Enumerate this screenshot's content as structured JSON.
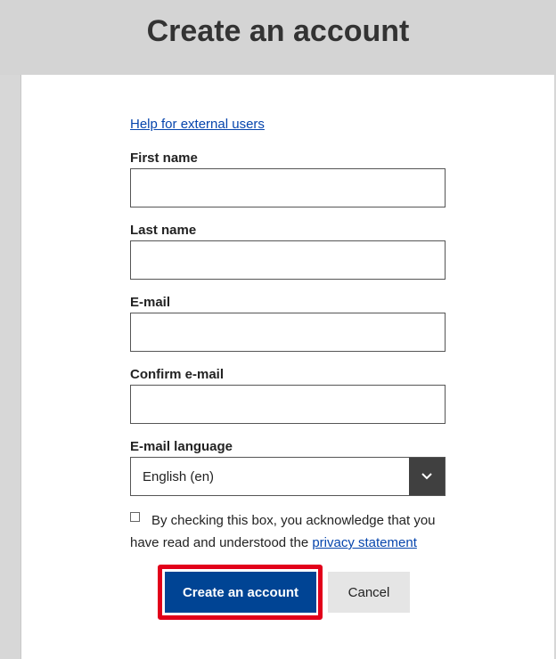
{
  "header": {
    "title": "Create an account"
  },
  "form": {
    "help_link": "Help for external users",
    "first_name": {
      "label": "First name",
      "value": ""
    },
    "last_name": {
      "label": "Last name",
      "value": ""
    },
    "email": {
      "label": "E-mail",
      "value": ""
    },
    "confirm_email": {
      "label": "Confirm e-mail",
      "value": ""
    },
    "email_language": {
      "label": "E-mail language",
      "selected": "English (en)",
      "arrow_icon": "chevron-down-icon"
    },
    "consent": {
      "checked": false,
      "text": "By checking this box, you acknowledge that you have read and understood the",
      "link": "privacy statement"
    },
    "buttons": {
      "create_label": "Create an account",
      "cancel_label": "Cancel"
    }
  },
  "colors": {
    "primary": "#004494",
    "link": "#0645ad",
    "highlight": "#e2001a",
    "header_bg": "#d4d4d4"
  }
}
